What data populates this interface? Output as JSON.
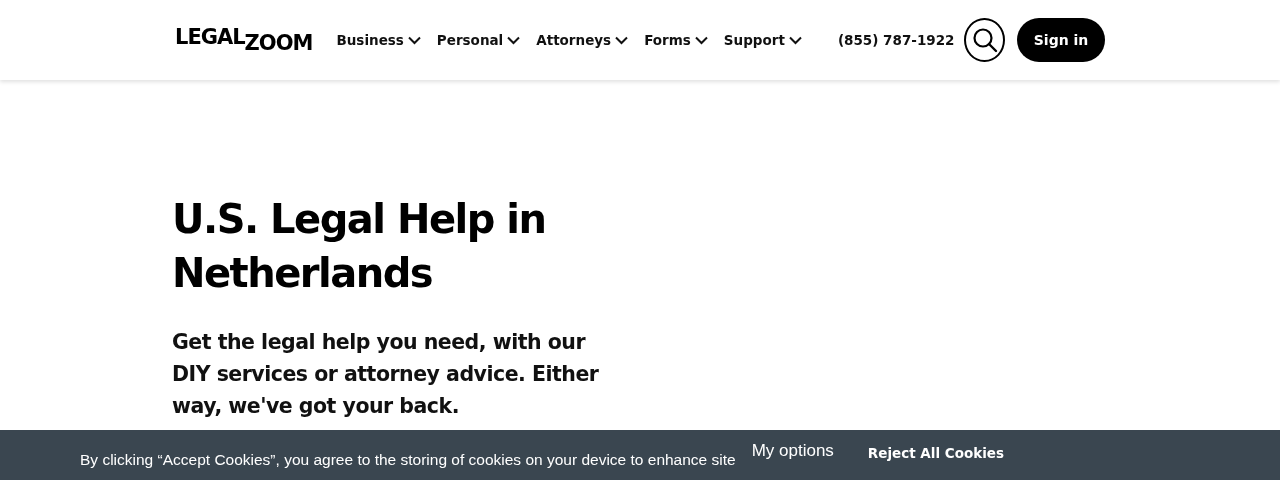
{
  "header": {
    "logo": "LEGAL$_{ZOOM}$",
    "nav": [
      {
        "label": "Business",
        "expanded": false
      },
      {
        "label": "Personal",
        "expanded": false
      },
      {
        "label": "Attorneys",
        "expanded": false
      },
      {
        "label": "Forms",
        "expanded": false
      },
      {
        "label": "Support",
        "expanded": false
      }
    ],
    "phone": "(855) 787-1922",
    "sign_in": "Sign in"
  },
  "hero": {
    "title": "U.S. Legal Help in Netherlands",
    "subtitle": "Get the legal help you need, with our DIY services or attorney advice. Either way, we've got your back."
  },
  "cookie_banner": {
    "text": "By clicking “Accept Cookies”, you agree to the storing of cookies on your device to enhance site",
    "options": "My options",
    "reject": "Reject All Cookies"
  }
}
